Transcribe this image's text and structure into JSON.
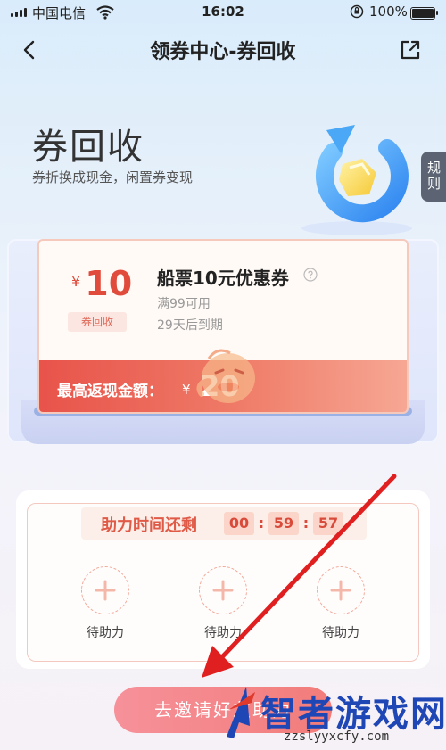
{
  "status_bar": {
    "carrier": "中国电信",
    "time": "16:02",
    "battery": "100%"
  },
  "nav": {
    "title": "领券中心-券回收"
  },
  "hero": {
    "title": "券回收",
    "subtitle": "券折换成现金，闲置券变现",
    "rules_label": "规则"
  },
  "coupon": {
    "currency": "¥",
    "amount": "10",
    "tag": "券回收",
    "name": "船票10元优惠券",
    "condition": "满99可用",
    "expiry": "29天后到期",
    "max_cash_label": "最高返现金额：",
    "max_cash_currency": "¥",
    "max_cash_value": "20"
  },
  "assist": {
    "timer_label": "助力时间还剩",
    "timer": [
      "00",
      "59",
      "57"
    ],
    "slots": [
      {
        "label": "待助力"
      },
      {
        "label": "待助力"
      },
      {
        "label": "待助力"
      }
    ]
  },
  "invite_button": "去邀请好友助力",
  "watermark": {
    "text": "智者游戏网",
    "url": "zzslyyxcfy.com"
  },
  "colors": {
    "accent_red": "#e04b3c",
    "recycle_blue": "#4aa8f6",
    "button_pink": "#f27c7a",
    "annotation_arrow": "#e02020"
  }
}
